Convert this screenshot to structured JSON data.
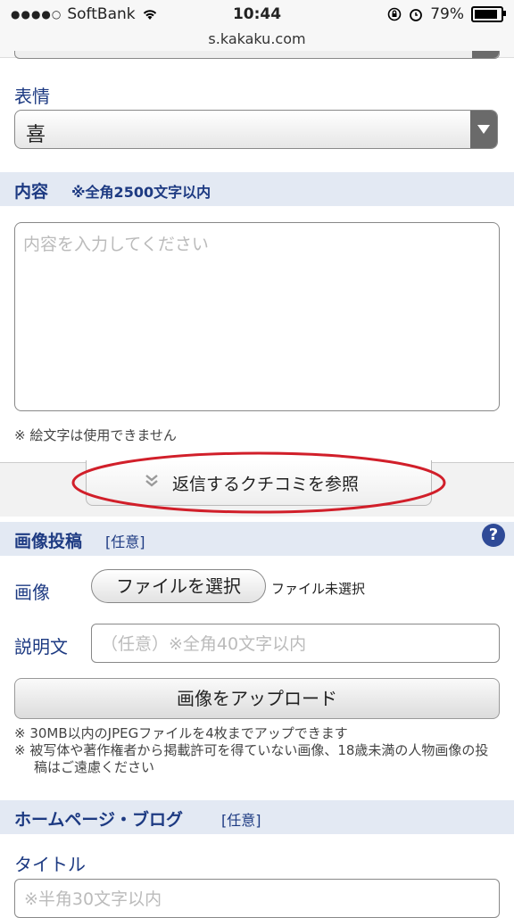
{
  "status_bar": {
    "signal_dots": "●●●●○",
    "carrier": "SoftBank",
    "time": "10:44",
    "battery": "79%",
    "url": "s.kakaku.com"
  },
  "expression": {
    "label": "表情",
    "selected": "喜"
  },
  "content": {
    "header": "内容",
    "limit_note": "※全角2500文字以内",
    "placeholder": "内容を入力してください",
    "emoji_note": "※ 絵文字は使用できません"
  },
  "reply_button": "返信するクチコミを参照",
  "image_post": {
    "header": "画像投稿",
    "optional": "[任意]",
    "help": "?",
    "image_label": "画像",
    "file_button": "ファイルを選択",
    "file_status": "ファイル未選択",
    "desc_label": "説明文",
    "desc_placeholder": "（任意）※全角40文字以内",
    "upload_button": "画像をアップロード",
    "notes": [
      "※ 30MB以内のJPEGファイルを4枚までアップできます",
      "※ 被写体や著作権者から掲載許可を得ていない画像、18歳未満の人物画像の投稿はご遠慮ください"
    ]
  },
  "homepage": {
    "header": "ホームページ・ブログ",
    "optional": "[任意]",
    "title_label": "タイトル",
    "title_placeholder": "※半角30文字以内"
  },
  "colors": {
    "accent_blue": "#1d3a82",
    "section_bg": "#e3e9f3",
    "highlight_red": "#d11f2a"
  }
}
